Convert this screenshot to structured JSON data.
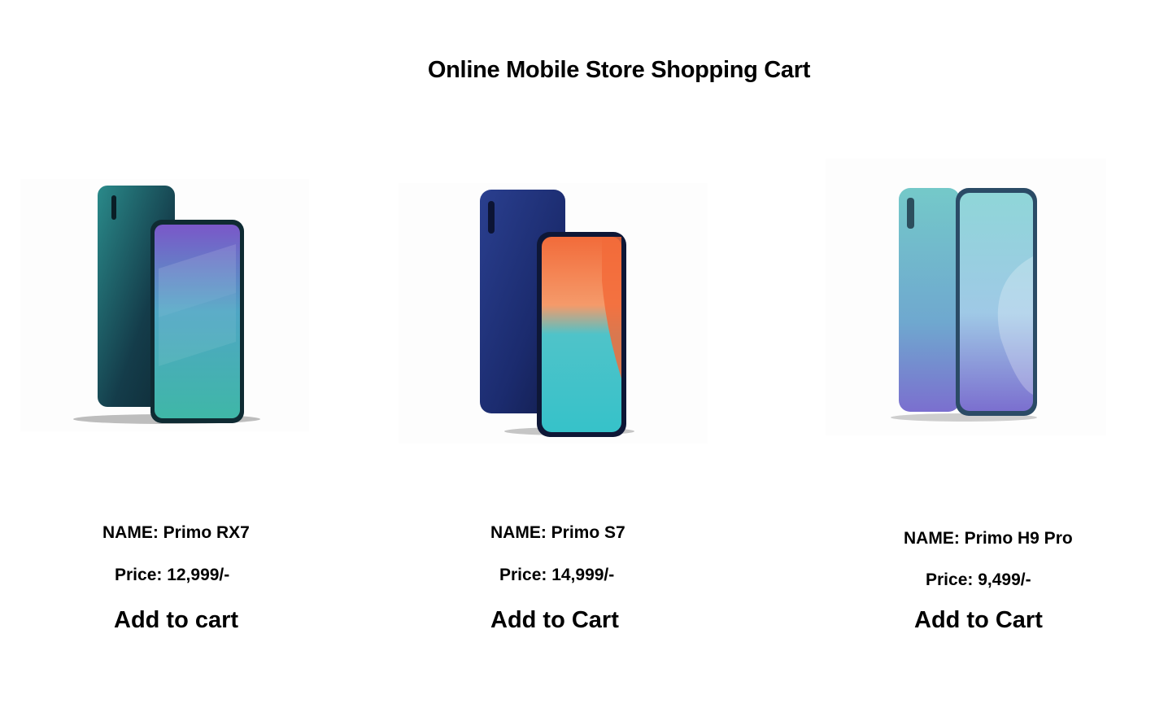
{
  "page": {
    "title": "Online Mobile Store Shopping Cart"
  },
  "products": [
    {
      "name": "NAME: Primo RX7",
      "price": "Price: 12,999/-",
      "button_label": "Add to cart",
      "colors": {
        "back": "#1f6f78",
        "screen_top": "#7a57c9",
        "screen_bottom": "#3fb7a7"
      }
    },
    {
      "name": "NAME: Primo S7",
      "price": "Price: 14,999/-",
      "button_label": "Add to Cart",
      "colors": {
        "back": "#1b2b6e",
        "screen_top": "#f26b3a",
        "screen_bottom": "#36c2c9"
      }
    },
    {
      "name": "NAME: Primo H9 Pro",
      "price": "Price: 9,499/-",
      "button_label": "Add to Cart",
      "colors": {
        "back": "#6ec2c5",
        "screen_top": "#8fd6d8",
        "screen_bottom": "#7b6fcf"
      }
    }
  ]
}
